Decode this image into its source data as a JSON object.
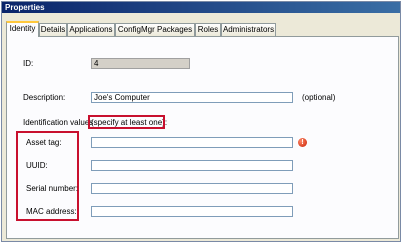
{
  "window": {
    "title": "Properties"
  },
  "tabs": [
    {
      "label": "Identity",
      "active": true
    },
    {
      "label": "Details"
    },
    {
      "label": "Applications"
    },
    {
      "label": "ConfigMgr Packages"
    },
    {
      "label": "Roles"
    },
    {
      "label": "Administrators"
    }
  ],
  "form": {
    "id_label": "ID:",
    "id_value": "4",
    "description_label": "Description:",
    "description_value": "Joe's Computer",
    "optional_note": "(optional)",
    "identification_label": "Identification values",
    "identification_hint": "(specify at least one):",
    "asset_tag_label": "Asset tag:",
    "asset_tag_value": "",
    "uuid_label": "UUID:",
    "uuid_value": "",
    "serial_label": "Serial number:",
    "serial_value": "",
    "mac_label": "MAC address:",
    "mac_value": "",
    "alert_glyph": "!"
  },
  "colors": {
    "highlight": "#c8102e",
    "alert": "#c81e00",
    "title_bar": "#0a246a"
  }
}
